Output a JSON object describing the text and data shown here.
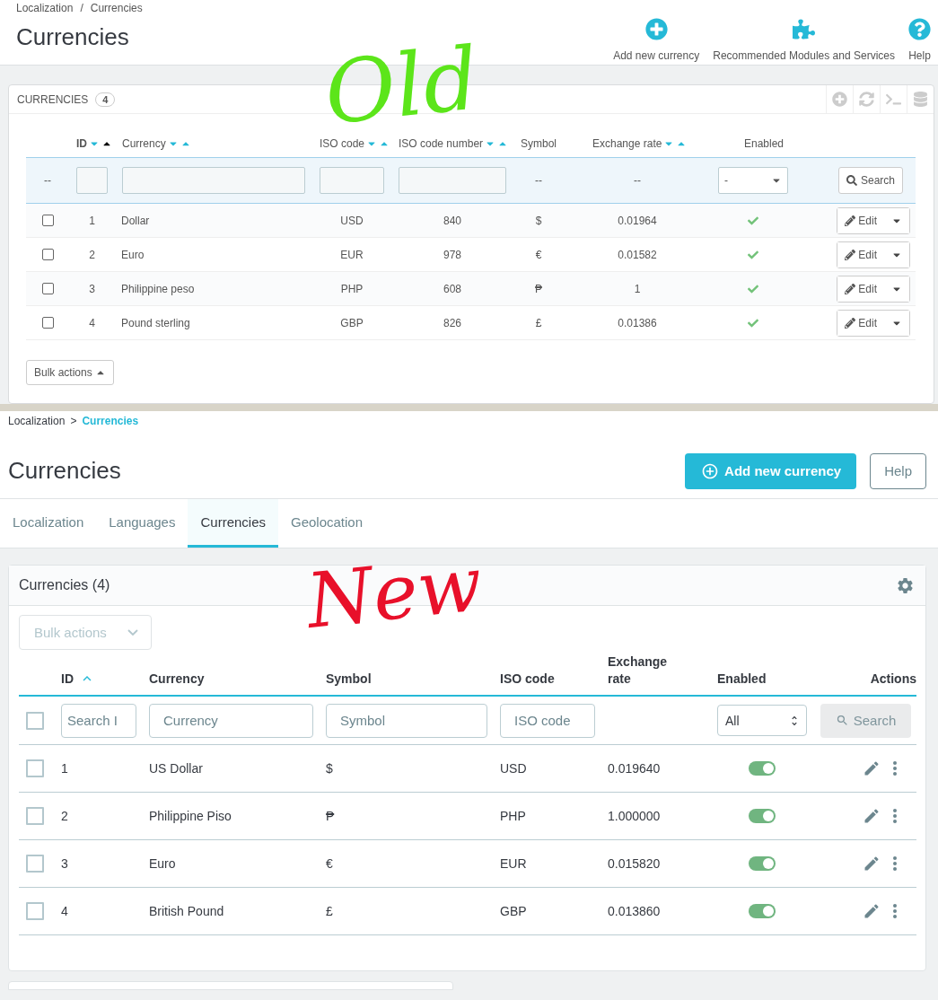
{
  "annotations": [
    {
      "text": "Old",
      "color": "#5ce51a"
    },
    {
      "text": "New",
      "color": "#e8102a"
    }
  ],
  "old": {
    "breadcrumb": [
      "Localization",
      "Currencies"
    ],
    "breadcrumb_separator": "/",
    "title": "Currencies",
    "toolbar": [
      {
        "kind": "add",
        "label": "Add new currency"
      },
      {
        "kind": "modules",
        "label": "Recommended Modules and Services"
      },
      {
        "kind": "help",
        "label": "Help"
      }
    ],
    "panel": {
      "title": "CURRENCIES",
      "count": "4"
    },
    "panel_tools": [
      {
        "kind": "add"
      },
      {
        "kind": "refresh"
      },
      {
        "kind": "terminal"
      },
      {
        "kind": "database"
      }
    ],
    "columns": [
      {
        "label": "ID",
        "selected": true
      },
      {
        "label": "Currency",
        "selected": false
      },
      {
        "label": "ISO code",
        "selected": false
      },
      {
        "label": "ISO code number",
        "selected": false
      },
      {
        "label": "Symbol"
      },
      {
        "label": "Exchange rate",
        "selected": false
      },
      {
        "label": "Enabled"
      }
    ],
    "filters": [
      {
        "kind": "text",
        "text": "--"
      },
      {
        "kind": "input"
      },
      {
        "kind": "input"
      },
      {
        "kind": "input"
      },
      {
        "kind": "input"
      },
      {
        "kind": "text",
        "text": "--"
      },
      {
        "kind": "text",
        "text": "--"
      },
      {
        "kind": "select",
        "value": "-"
      },
      {
        "kind": "button",
        "label": "Search"
      }
    ],
    "rows": [
      {
        "checked": false,
        "id": "1",
        "currency": "Dollar",
        "iso": "USD",
        "iso_number": "840",
        "symbol": "$",
        "rate": "0.01964",
        "enabled": true,
        "action": "Edit"
      },
      {
        "checked": false,
        "id": "2",
        "currency": "Euro",
        "iso": "EUR",
        "iso_number": "978",
        "symbol": "€",
        "rate": "0.01582",
        "enabled": true,
        "action": "Edit"
      },
      {
        "checked": false,
        "id": "3",
        "currency": "Philippine peso",
        "iso": "PHP",
        "iso_number": "608",
        "symbol": "₱",
        "rate": "1",
        "enabled": true,
        "action": "Edit"
      },
      {
        "checked": false,
        "id": "4",
        "currency": "Pound sterling",
        "iso": "GBP",
        "iso_number": "826",
        "symbol": "£",
        "rate": "0.01386",
        "enabled": true,
        "action": "Edit"
      }
    ],
    "bulk_actions": "Bulk actions"
  },
  "new": {
    "breadcrumb": [
      "Localization",
      "Currencies"
    ],
    "breadcrumb_separator": ">",
    "title": "Currencies",
    "add_button": "Add new currency",
    "help_button": "Help",
    "tabs": [
      {
        "label": "Localization",
        "selected": false
      },
      {
        "label": "Languages",
        "selected": false
      },
      {
        "label": "Currencies",
        "selected": true
      },
      {
        "label": "Geolocation",
        "selected": false
      }
    ],
    "card_title": "Currencies (4)",
    "bulk_actions": "Bulk actions",
    "columns": [
      {
        "label": "ID",
        "sorted": true
      },
      {
        "label": "Currency"
      },
      {
        "label": "Symbol"
      },
      {
        "label": "ISO code"
      },
      {
        "label": "Exchange rate"
      },
      {
        "label": "Enabled"
      },
      {
        "label": "Actions"
      }
    ],
    "filters": [
      {
        "kind": "checkbox",
        "checked": false
      },
      {
        "kind": "input",
        "placeholder": "Search I"
      },
      {
        "kind": "input",
        "placeholder": "Currency"
      },
      {
        "kind": "input",
        "placeholder": "Symbol"
      },
      {
        "kind": "input",
        "placeholder": "ISO code"
      },
      {
        "kind": "blank"
      },
      {
        "kind": "select",
        "value": "All"
      },
      {
        "kind": "button",
        "label": "Search",
        "disabled": true
      }
    ],
    "rows": [
      {
        "checked": false,
        "id": "1",
        "currency": "US Dollar",
        "symbol": "$",
        "iso": "USD",
        "rate": "0.019640",
        "enabled": true
      },
      {
        "checked": false,
        "id": "2",
        "currency": "Philippine Piso",
        "symbol": "₱",
        "iso": "PHP",
        "rate": "1.000000",
        "enabled": true
      },
      {
        "checked": false,
        "id": "3",
        "currency": "Euro",
        "symbol": "€",
        "iso": "EUR",
        "rate": "0.015820",
        "enabled": true
      },
      {
        "checked": false,
        "id": "4",
        "currency": "British Pound",
        "symbol": "£",
        "iso": "GBP",
        "rate": "0.013860",
        "enabled": true
      }
    ]
  }
}
